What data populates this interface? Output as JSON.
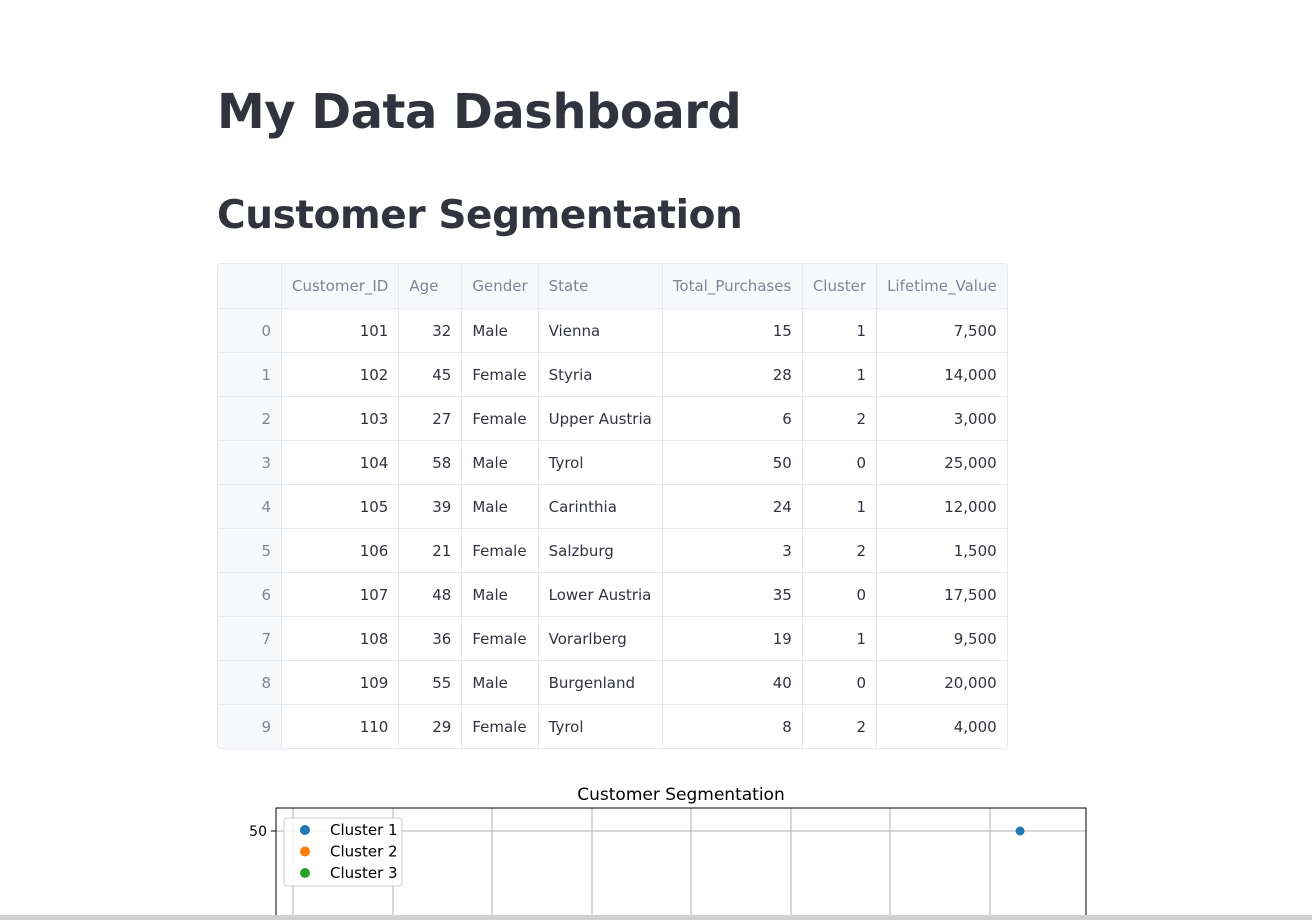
{
  "page": {
    "title": "My Data Dashboard",
    "section_title": "Customer Segmentation"
  },
  "table": {
    "columns": [
      "",
      "Customer_ID",
      "Age",
      "Gender",
      "State",
      "Total_Purchases",
      "Cluster",
      "Lifetime_Value"
    ],
    "rows": [
      [
        "0",
        "101",
        "32",
        "Male",
        "Vienna",
        "15",
        "1",
        "7,500"
      ],
      [
        "1",
        "102",
        "45",
        "Female",
        "Styria",
        "28",
        "1",
        "14,000"
      ],
      [
        "2",
        "103",
        "27",
        "Female",
        "Upper Austria",
        "6",
        "2",
        "3,000"
      ],
      [
        "3",
        "104",
        "58",
        "Male",
        "Tyrol",
        "50",
        "0",
        "25,000"
      ],
      [
        "4",
        "105",
        "39",
        "Male",
        "Carinthia",
        "24",
        "1",
        "12,000"
      ],
      [
        "5",
        "106",
        "21",
        "Female",
        "Salzburg",
        "3",
        "2",
        "1,500"
      ],
      [
        "6",
        "107",
        "48",
        "Male",
        "Lower Austria",
        "35",
        "0",
        "17,500"
      ],
      [
        "7",
        "108",
        "36",
        "Female",
        "Vorarlberg",
        "19",
        "1",
        "9,500"
      ],
      [
        "8",
        "109",
        "55",
        "Male",
        "Burgenland",
        "40",
        "0",
        "20,000"
      ],
      [
        "9",
        "110",
        "29",
        "Female",
        "Tyrol",
        "8",
        "2",
        "4,000"
      ]
    ]
  },
  "chart_data": {
    "type": "scatter",
    "title": "Customer Segmentation",
    "xlabel": "",
    "ylabel": "",
    "y_tick_labels": [
      "50"
    ],
    "grid": true,
    "legend_position": "top-left",
    "series": [
      {
        "name": "Cluster 1",
        "color": "#1f77b4",
        "points": [
          {
            "x": 58,
            "y": 50
          }
        ]
      },
      {
        "name": "Cluster 2",
        "color": "#ff7f0e",
        "points": []
      },
      {
        "name": "Cluster 3",
        "color": "#2ca02c",
        "points": []
      }
    ]
  }
}
